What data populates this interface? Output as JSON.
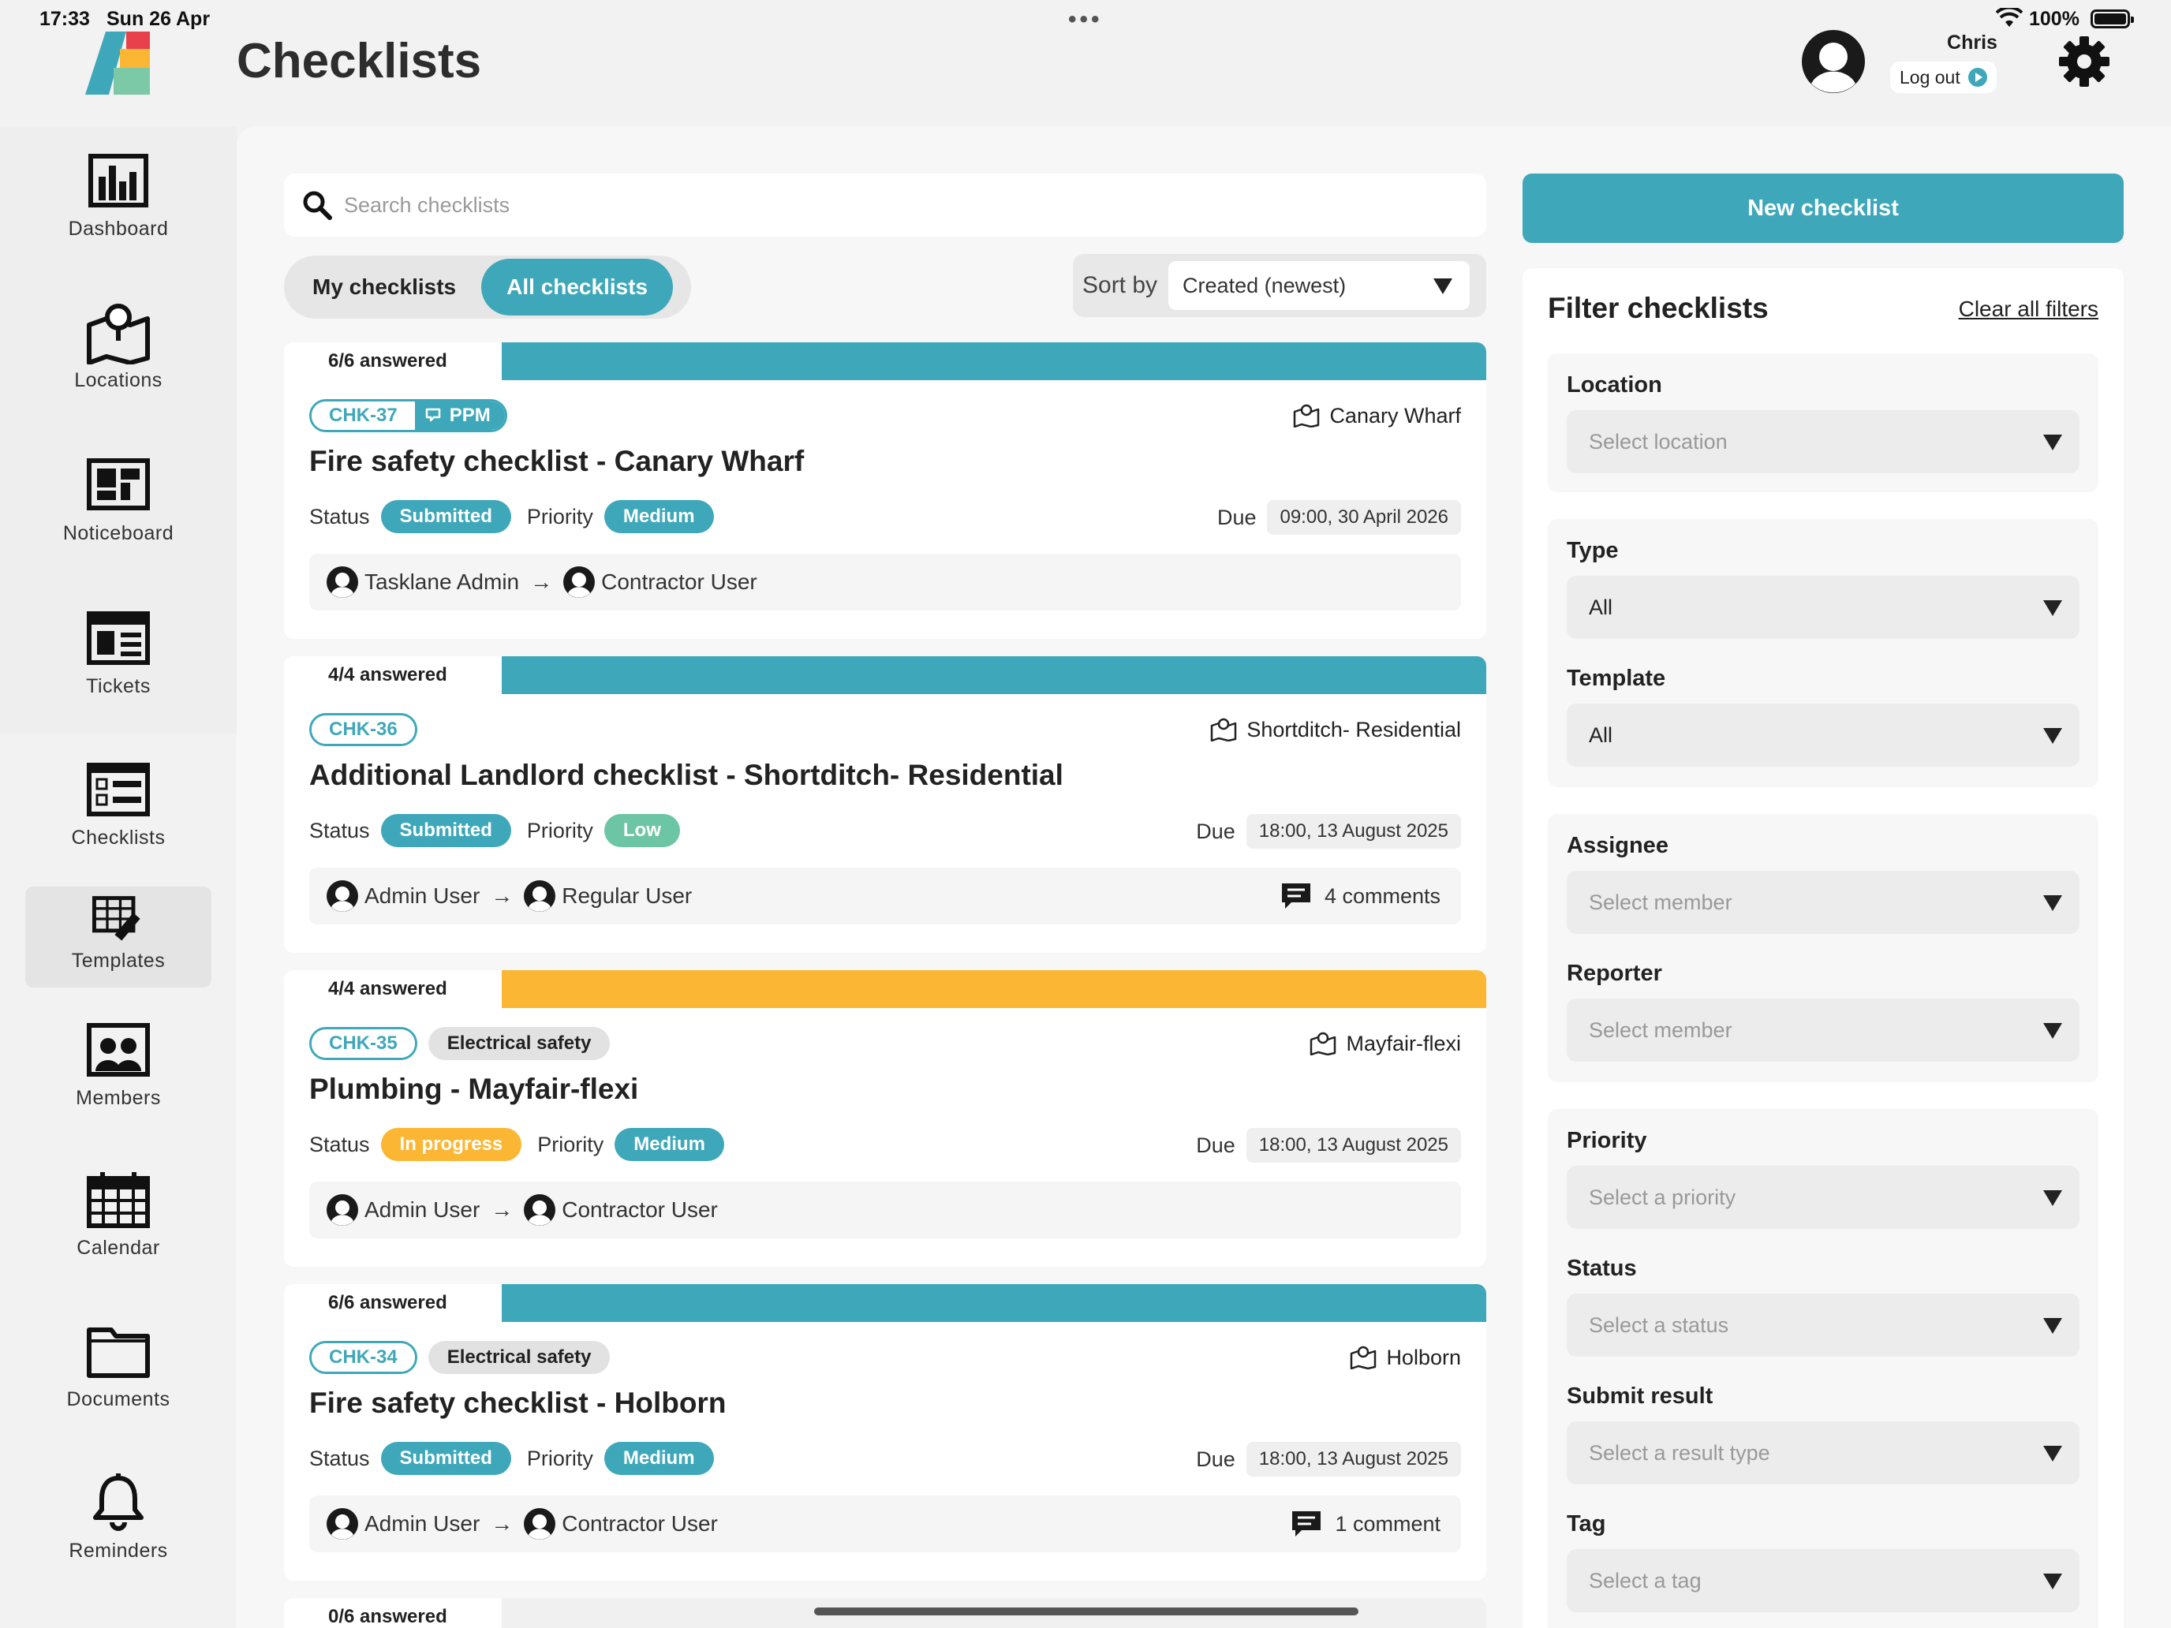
{
  "status_bar": {
    "time": "17:33",
    "date": "Sun 26 Apr",
    "battery": "100%"
  },
  "header": {
    "title": "Checklists",
    "user": "Chris",
    "logout": "Log out"
  },
  "sidebar": [
    {
      "label": "Dashboard",
      "icon": "dashboard-icon"
    },
    {
      "label": "Locations",
      "icon": "map-pin-icon"
    },
    {
      "label": "Noticeboard",
      "icon": "noticeboard-icon"
    },
    {
      "label": "Tickets",
      "icon": "tickets-icon"
    },
    {
      "label": "Checklists",
      "icon": "checklist-icon"
    },
    {
      "label": "Templates",
      "icon": "templates-icon"
    },
    {
      "label": "Members",
      "icon": "members-icon"
    },
    {
      "label": "Calendar",
      "icon": "calendar-icon"
    },
    {
      "label": "Documents",
      "icon": "folder-icon"
    },
    {
      "label": "Reminders",
      "icon": "bell-icon"
    }
  ],
  "toolbar": {
    "search_placeholder": "Search checklists",
    "tab_mine": "My checklists",
    "tab_all": "All checklists",
    "sort_label": "Sort by",
    "sort_value": "Created (newest)"
  },
  "labels": {
    "status": "Status",
    "priority": "Priority",
    "due": "Due"
  },
  "colors": {
    "teal": "#3ea8ba",
    "amber": "#fbb734",
    "green": "#6cc5a4"
  },
  "checklists": [
    {
      "answered": "6/6 answered",
      "id": "CHK-37",
      "ppm": "PPM",
      "tag": "",
      "location": "Canary Wharf",
      "title": "Fire safety checklist  - Canary Wharf",
      "status": "Submitted",
      "priority": "Medium",
      "due": "09:00, 30 April 2026",
      "from": "Tasklane Admin",
      "to": "Contractor User",
      "comments": ""
    },
    {
      "answered": "4/4 answered",
      "id": "CHK-36",
      "ppm": "",
      "tag": "",
      "location": "Shortditch- Residential",
      "title": "Additional Landlord checklist  - Shortditch- Residential",
      "status": "Submitted",
      "priority": "Low",
      "due": "18:00, 13 August 2025",
      "from": "Admin User",
      "to": "Regular User",
      "comments": "4 comments"
    },
    {
      "answered": "4/4 answered",
      "id": "CHK-35",
      "ppm": "",
      "tag": "Electrical safety",
      "location": "Mayfair-flexi",
      "title": "Plumbing  - Mayfair-flexi",
      "status": "In progress",
      "priority": "Medium",
      "due": "18:00, 13 August 2025",
      "from": "Admin User",
      "to": "Contractor User",
      "comments": ""
    },
    {
      "answered": "6/6 answered",
      "id": "CHK-34",
      "ppm": "",
      "tag": "Electrical safety",
      "location": "Holborn",
      "title": "Fire safety checklist  - Holborn",
      "status": "Submitted",
      "priority": "Medium",
      "due": "18:00, 13 August 2025",
      "from": "Admin User",
      "to": "Contractor User",
      "comments": "1 comment"
    },
    {
      "answered": "0/6 answered"
    }
  ],
  "right": {
    "new_button": "New checklist",
    "filter_title": "Filter checklists",
    "clear": "Clear all filters",
    "location_label": "Location",
    "location_value": "Select location",
    "type_label": "Type",
    "type_value": "All",
    "template_label": "Template",
    "template_value": "All",
    "assignee_label": "Assignee",
    "assignee_value": "Select member",
    "reporter_label": "Reporter",
    "reporter_value": "Select member",
    "priority_label": "Priority",
    "priority_value": "Select a priority",
    "status_label": "Status",
    "status_value": "Select a status",
    "submit_label": "Submit result",
    "submit_value": "Select a result type",
    "tag_label": "Tag",
    "tag_value": "Select a tag"
  }
}
